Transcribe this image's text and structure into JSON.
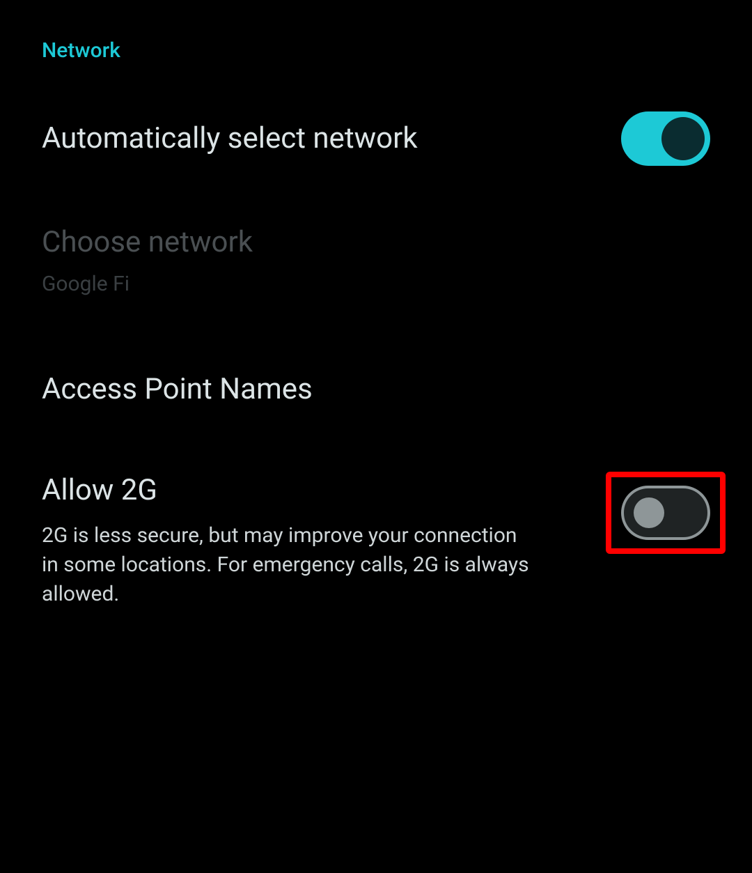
{
  "section_header": "Network",
  "auto_select": {
    "title": "Automatically select network",
    "enabled": true
  },
  "choose_network": {
    "title": "Choose network",
    "value": "Google Fi"
  },
  "apn": {
    "title": "Access Point Names"
  },
  "allow_2g": {
    "title": "Allow 2G",
    "description": "2G is less secure, but may improve your connection in some locations. For emergency calls, 2G is always allowed.",
    "enabled": false
  }
}
